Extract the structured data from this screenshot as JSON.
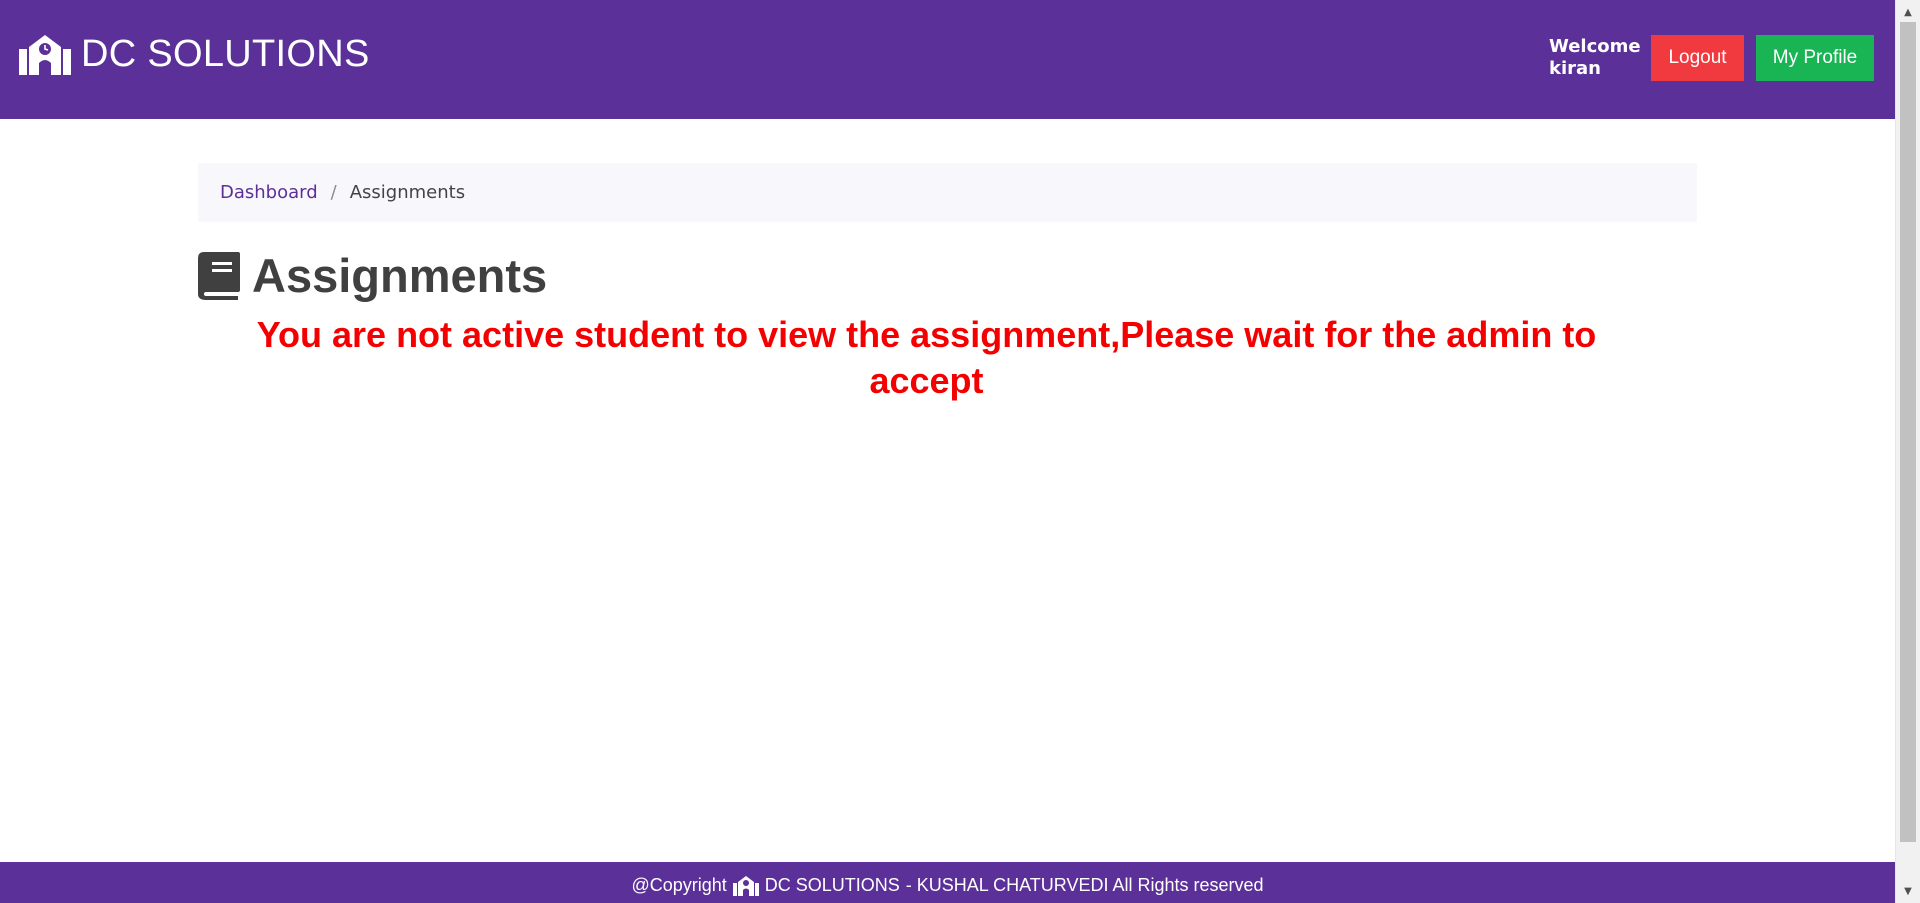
{
  "header": {
    "brand": "DC SOLUTIONS",
    "welcome_line1": "Welcome",
    "welcome_line2": "kiran",
    "logout_label": "Logout",
    "profile_label": "My Profile"
  },
  "breadcrumb": {
    "home": "Dashboard",
    "separator": "/",
    "current": "Assignments"
  },
  "page": {
    "title": "Assignments",
    "notice": "You are not active student to view the assignment,Please wait for the admin to accept"
  },
  "footer": {
    "prefix": "@Copyright",
    "brand": "DC SOLUTIONS",
    "suffix": "- KUSHAL CHATURVEDI All Rights reserved"
  },
  "icons": {
    "brand": "school-icon",
    "title": "book-icon"
  },
  "colors": {
    "primary": "#5b3098",
    "logout": "#f13a3f",
    "profile": "#19b454",
    "notice": "#f40000",
    "breadcrumb_bg": "#f8f7fc"
  }
}
